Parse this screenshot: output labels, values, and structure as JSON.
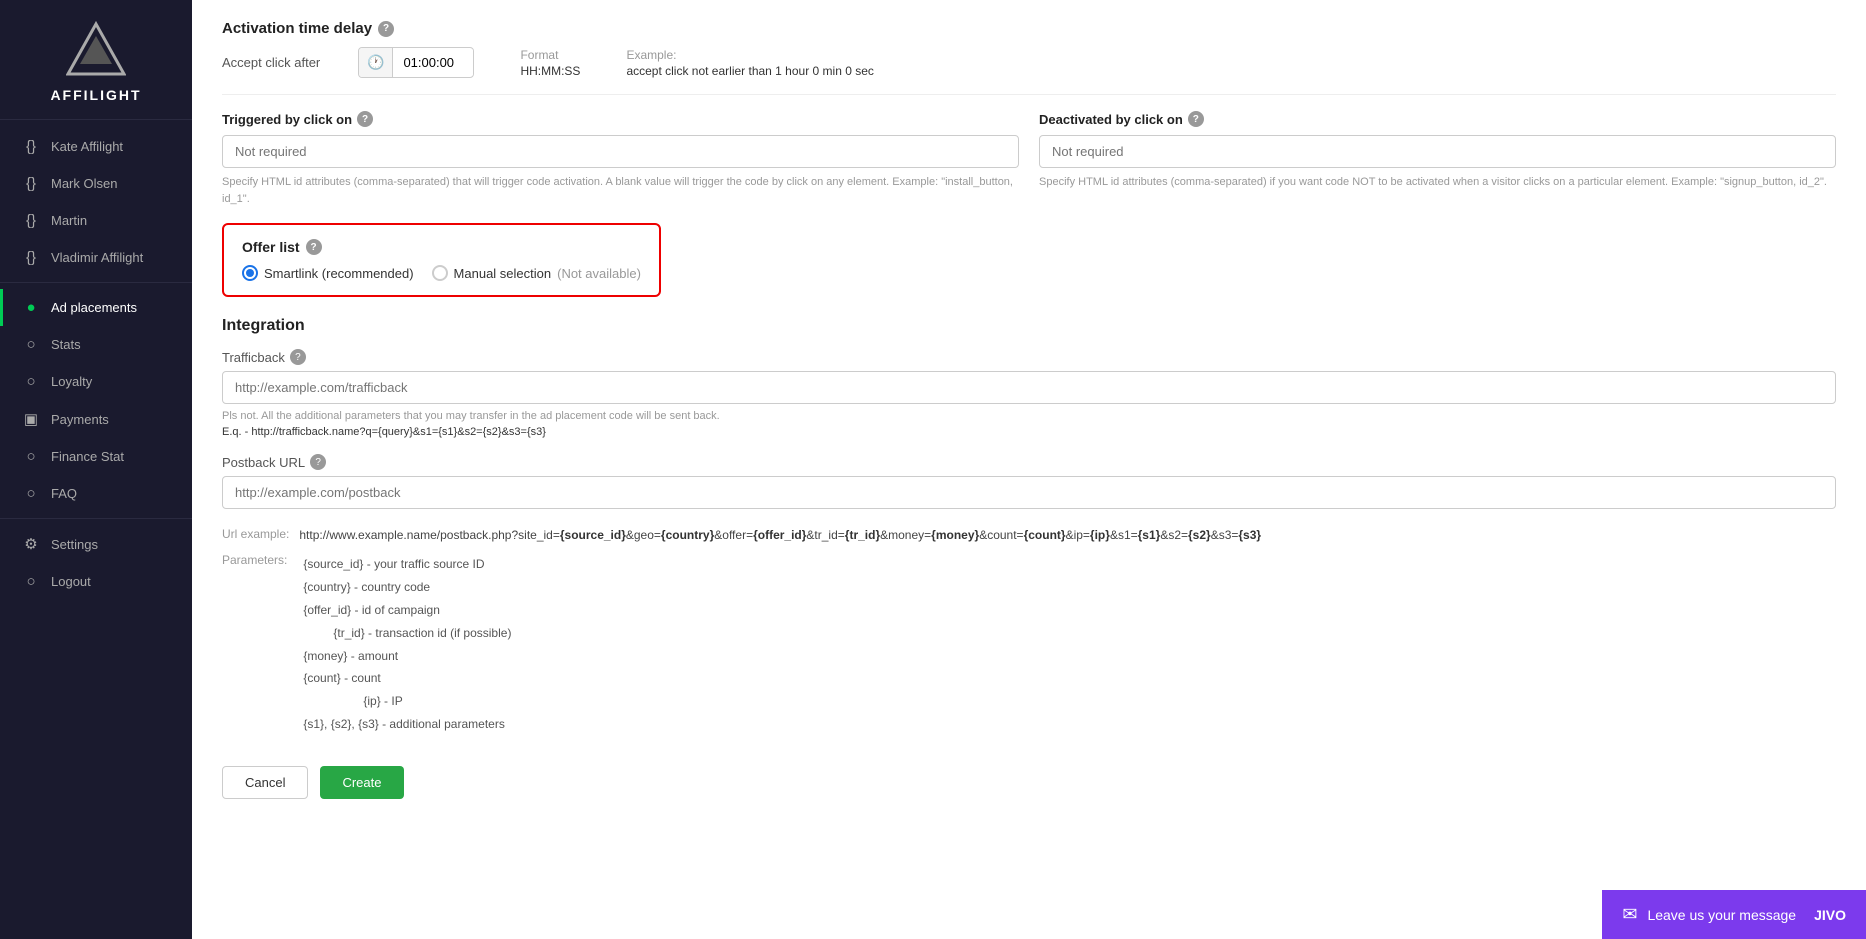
{
  "logo": {
    "text": "AFFILIGHT"
  },
  "sidebar": {
    "items": [
      {
        "id": "kate",
        "label": "Kate Affilight",
        "icon": "{}",
        "active": false
      },
      {
        "id": "mark",
        "label": "Mark Olsen",
        "icon": "{}",
        "active": false
      },
      {
        "id": "martin",
        "label": "Martin",
        "icon": "{}",
        "active": false
      },
      {
        "id": "vladimir",
        "label": "Vladimir Affilight",
        "icon": "{}",
        "active": false
      },
      {
        "id": "ad-placements",
        "label": "Ad placements",
        "icon": "○",
        "active": true
      },
      {
        "id": "stats",
        "label": "Stats",
        "icon": "○",
        "active": false
      },
      {
        "id": "loyalty",
        "label": "Loyalty",
        "icon": "○",
        "active": false
      },
      {
        "id": "payments",
        "label": "Payments",
        "icon": "▣",
        "active": false
      },
      {
        "id": "finance-stat",
        "label": "Finance Stat",
        "icon": "○",
        "active": false
      },
      {
        "id": "faq",
        "label": "FAQ",
        "icon": "○",
        "active": false
      },
      {
        "id": "settings",
        "label": "Settings",
        "icon": "⚙",
        "active": false
      },
      {
        "id": "logout",
        "label": "Logout",
        "icon": "○",
        "active": false
      }
    ]
  },
  "main": {
    "activation_time_delay": {
      "section_title": "Activation time delay",
      "accept_click_after_label": "Accept click after",
      "time_value": "01:00:00",
      "format_label": "Format",
      "format_value": "HH:MM:SS",
      "example_label": "Example:",
      "example_value": "accept click not earlier than 1 hour 0 min 0 sec"
    },
    "triggered_by_click": {
      "label": "Triggered by click on",
      "placeholder": "Not required",
      "hint": "Specify HTML id attributes (comma-separated) that will trigger code activation. A blank value will trigger the code by click on any element. Example: \"install_button, id_1\"."
    },
    "deactivated_by_click": {
      "label": "Deactivated by click on",
      "placeholder": "Not required",
      "hint": "Specify HTML id attributes (comma-separated) if you want code NOT to be activated when a visitor clicks on a particular element. Example: \"signup_button, id_2\"."
    },
    "offer_list": {
      "title": "Offer list",
      "options": [
        {
          "id": "smartlink",
          "label": "Smartlink (recommended)",
          "selected": true
        },
        {
          "id": "manual",
          "label": "Manual selection",
          "sublabel": "(Not available)",
          "selected": false
        }
      ]
    },
    "integration": {
      "title": "Integration",
      "trafficback": {
        "label": "Trafficback",
        "placeholder": "http://example.com/trafficback",
        "note1": "Pls not. All the additional parameters that you may transfer in the ad placement code will be sent back.",
        "note2": "E.q. - http://trafficback.name?q={query}&s1={s1}&s2={s2}&s3={s3}"
      },
      "postback_url": {
        "label": "Postback URL",
        "placeholder": "http://example.com/postback"
      },
      "url_example_key": "Url example:",
      "url_example_value": "http://www.example.name/postback.php?site_id={source_id}&geo={country}&offer={offer_id}&tr_id={tr_id}&money={money}&count={count}&ip={ip}&s1={s1}&s2={s2}&s3={s3}",
      "parameters_key": "Parameters:",
      "parameters": [
        "{source_id} - your traffic source ID",
        "{country} - country code",
        "{offer_id} - id of campaign",
        "{tr_id} - transaction id (if possible)",
        "{money} - amount",
        "{count} - count",
        "{ip} - IP",
        "{s1}, {s2}, {s3} - additional parameters"
      ]
    },
    "buttons": {
      "cancel": "Cancel",
      "create": "Create"
    }
  },
  "jivo": {
    "label": "Leave us your message",
    "brand": "JIVO"
  }
}
